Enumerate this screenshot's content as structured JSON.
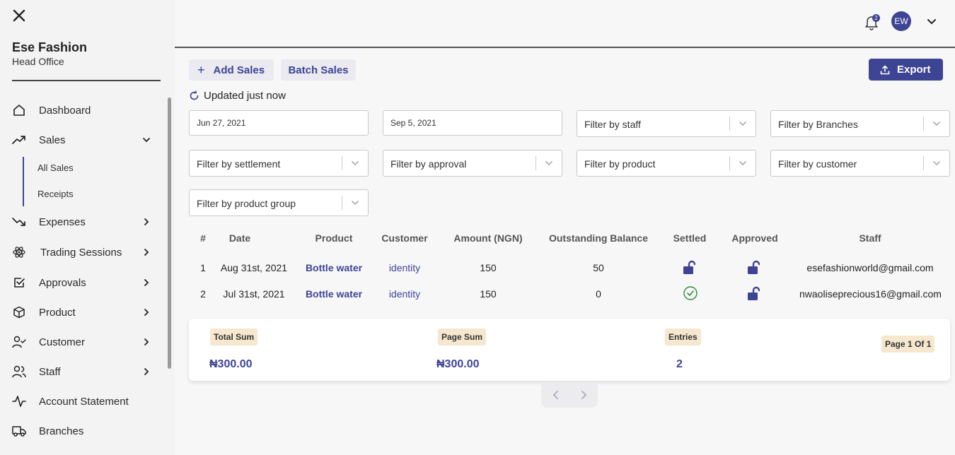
{
  "sidebar": {
    "org_name": "Ese Fashion",
    "org_sub": "Head Office",
    "nav": [
      {
        "label": "Dashboard"
      },
      {
        "label": "Sales"
      },
      {
        "label": "Expenses"
      },
      {
        "label": "Trading Sessions"
      },
      {
        "label": "Approvals"
      },
      {
        "label": "Product"
      },
      {
        "label": "Customer"
      },
      {
        "label": "Staff"
      },
      {
        "label": "Account Statement"
      },
      {
        "label": "Branches"
      }
    ],
    "sales_sub": [
      "All Sales",
      "Receipts"
    ]
  },
  "header": {
    "notification_count": "2",
    "avatar_initials": "EW"
  },
  "actions": {
    "add_plus": "+",
    "add_sales": "Add Sales",
    "batch_sales": "Batch Sales",
    "export": "Export",
    "updated": "Updated just now"
  },
  "filters": {
    "date_from": "Jun 27, 2021",
    "date_to": "Sep 5, 2021",
    "staff": "Filter by staff",
    "branches": "Filter by Branches",
    "settlement": "Filter by settlement",
    "approval": "Filter by approval",
    "product": "Filter by product",
    "customer": "Filter by customer",
    "product_group": "Filter by product group"
  },
  "table": {
    "headers": [
      "#",
      "Date",
      "Product",
      "Customer",
      "Amount (NGN)",
      "Outstanding Balance",
      "Settled",
      "Approved",
      "Staff"
    ],
    "rows": [
      {
        "num": "1",
        "date": "Aug 31st, 2021",
        "product": "Bottle water",
        "customer": "identity",
        "amount": "150",
        "outstanding": "50",
        "settled": false,
        "approved": false,
        "staff": "esefashionworld@gmail.com"
      },
      {
        "num": "2",
        "date": "Jul 31st, 2021",
        "product": "Bottle water",
        "customer": "identity",
        "amount": "150",
        "outstanding": "0",
        "settled": true,
        "approved": false,
        "staff": "nwaoliseprecious16@gmail.com"
      }
    ]
  },
  "summary": {
    "total_label": "Total Sum",
    "total_value": "₦300.00",
    "page_label": "Page Sum",
    "page_value": "₦300.00",
    "entries_label": "Entries",
    "entries_value": "2",
    "page_info": "Page 1 Of 1"
  },
  "colors": {
    "accent": "#3e4494",
    "tag_bg": "#f5e8cf",
    "settled_green": "#2e8b3a"
  },
  "icons": [
    "close-icon",
    "home-icon",
    "trend-up-icon",
    "trend-down-icon",
    "atom-icon",
    "checkbox-icon",
    "box-icon",
    "user-check-icon",
    "users-icon",
    "activity-icon",
    "truck-icon",
    "bell-icon",
    "chevron-down-icon",
    "chevron-right-icon",
    "upload-icon",
    "refresh-icon",
    "unlock-icon",
    "check-circle-icon",
    "chevron-left-icon"
  ]
}
